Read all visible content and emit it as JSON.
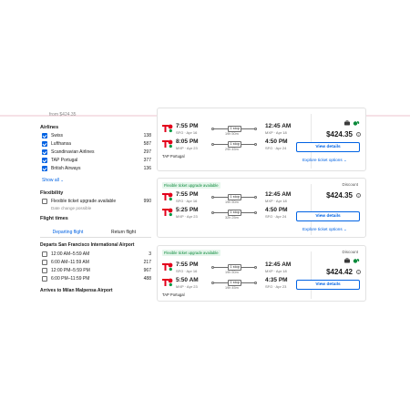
{
  "filters": {
    "from_price": "from $424.35",
    "airlines_title": "Airlines",
    "airlines": [
      {
        "name": "Swiss",
        "count": "138",
        "checked": true
      },
      {
        "name": "Lufthansa",
        "count": "587",
        "checked": true
      },
      {
        "name": "Scandinavian Airlines",
        "count": "297",
        "checked": true
      },
      {
        "name": "TAP Portugal",
        "count": "377",
        "checked": true
      },
      {
        "name": "British Airways",
        "count": "136",
        "checked": true
      }
    ],
    "show_all": "Show all",
    "flexibility_title": "Flexibility",
    "flex_option": {
      "name": "Flexible ticket upgrade available",
      "count": "990",
      "note": "Date change possible"
    },
    "flight_times_title": "Flight times",
    "tabs": [
      "Departing flight",
      "Return flight"
    ],
    "departs_title": "Departs San Francisco International Airport",
    "departs_slots": [
      {
        "label": "12:00 AM–5:59 AM",
        "count": "3"
      },
      {
        "label": "6:00 AM–11:59 AM",
        "count": "217"
      },
      {
        "label": "12:00 PM–5:59 PM",
        "count": "967"
      },
      {
        "label": "6:00 PM–11:59 PM",
        "count": "488"
      }
    ],
    "arrives_title": "Arrives to Milan Malpensa Airport"
  },
  "results": [
    {
      "badge": "",
      "deal": "",
      "legs": [
        {
          "dep": "7:55 PM",
          "dep_airport": "SFO · Apr 16",
          "stops": "1 stop",
          "duration": "19h 50m",
          "arr": "12:45 AM",
          "arr_airport": "MXP · Apr 18"
        },
        {
          "dep": "8:05 PM",
          "dep_airport": "MXP · Apr 23",
          "stops": "1 stop",
          "duration": "29h 45m",
          "arr": "4:50 PM",
          "arr_airport": "SFO · Apr 24"
        }
      ],
      "carrier": "TAP Portugal",
      "price": "$424.35",
      "view": "View details",
      "explore": "Explore ticket options"
    },
    {
      "badge": "Flexible ticket upgrade available",
      "deal": "Discount",
      "legs": [
        {
          "dep": "7:55 PM",
          "dep_airport": "SFO · Apr 16",
          "stops": "1 stop",
          "duration": "19h 50m",
          "arr": "12:45 AM",
          "arr_airport": "MXP · Apr 18"
        },
        {
          "dep": "5:25 PM",
          "dep_airport": "MXP · Apr 23",
          "stops": "1 stop",
          "duration": "32h 25m",
          "arr": "4:50 PM",
          "arr_airport": "SFO · Apr 24"
        }
      ],
      "carrier": "",
      "price": "$424.35",
      "view": "View details",
      "explore": "Explore ticket options"
    },
    {
      "badge": "Flexible ticket upgrade available",
      "deal": "Discount",
      "legs": [
        {
          "dep": "7:55 PM",
          "dep_airport": "SFO · Apr 16",
          "stops": "1 stop",
          "duration": "19h 50m",
          "arr": "12:45 AM",
          "arr_airport": "MXP · Apr 18"
        },
        {
          "dep": "5:50 AM",
          "dep_airport": "MXP · Apr 23",
          "stops": "1 stop",
          "duration": "19h 45m",
          "arr": "4:35 PM",
          "arr_airport": "SFO · Apr 23"
        }
      ],
      "carrier": "TAP Portugal",
      "price": "$424.42",
      "view": "View details",
      "explore": ""
    }
  ],
  "colors": {
    "accent": "#0062e3",
    "green": "#0a8a3a",
    "tap_red": "#e3001b",
    "tap_green": "#009a44"
  }
}
